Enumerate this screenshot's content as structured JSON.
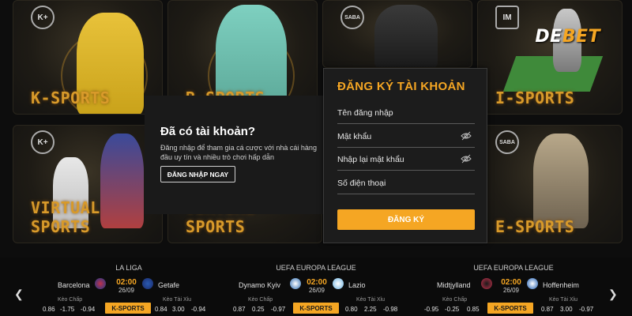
{
  "brand": {
    "left": "DE",
    "right": "BET"
  },
  "tiles": {
    "ksports": {
      "label": "K-SPORTS",
      "logo": "K+"
    },
    "bsports": {
      "label": "B-SPORTS"
    },
    "ssports": {
      "logo": "SABA"
    },
    "isports": {
      "label": "I-SPORTS",
      "logo": "IM"
    },
    "virtual1": {
      "label": "VIRTUAL SPORTS",
      "logo": "K+"
    },
    "virtual2": {
      "label": "VIRTUAL SPORTS"
    },
    "esports": {
      "label": "E-SPORTS",
      "logo": "SABA"
    }
  },
  "login": {
    "title": "Đã có tài khoản?",
    "description": "Đăng nhập để tham gia cá cược với nhà cái hàng đầu uy tín và nhiều trò chơi hấp dẫn",
    "button": "ĐĂNG NHẬP NGAY"
  },
  "register": {
    "title": "ĐĂNG KÝ TÀI KHOẢN",
    "fields": [
      {
        "placeholder": "Tên đăng nhập"
      },
      {
        "placeholder": "Mật khẩu"
      },
      {
        "placeholder": "Nhập lại mật khẩu"
      },
      {
        "placeholder": "Số điện thoại"
      }
    ],
    "button": "ĐĂNG KÝ"
  },
  "matches": [
    {
      "league": "LA LIGA",
      "home": "Barcelona",
      "away": "Getafe",
      "time": "02:00",
      "date": "26/09",
      "handicap_label": "Kèo Chấp",
      "total_label": "Kèo Tài Xỉu",
      "handicap": [
        "0.86",
        "-1.75",
        "-0.94"
      ],
      "total": [
        "0.84",
        "3.00",
        "-0.94"
      ],
      "chip": "K-SPORTS"
    },
    {
      "league": "UEFA EUROPA LEAGUE",
      "home": "Dynamo Kyiv",
      "away": "Lazio",
      "time": "02:00",
      "date": "26/09",
      "handicap_label": "Kèo Chấp",
      "total_label": "Kèo Tài Xỉu",
      "handicap": [
        "0.87",
        "0.25",
        "-0.97"
      ],
      "total": [
        "0.80",
        "2.25",
        "-0.98"
      ],
      "chip": "K-SPORTS"
    },
    {
      "league": "UEFA EUROPA LEAGUE",
      "home": "Midtjylland",
      "away": "Hoffenheim",
      "time": "02:00",
      "date": "26/09",
      "handicap_label": "Kèo Chấp",
      "total_label": "Kèo Tài Xỉu",
      "handicap": [
        "-0.95",
        "-0.25",
        "0.85"
      ],
      "total": [
        "0.87",
        "3.00",
        "-0.97"
      ],
      "chip": "K-SPORTS"
    }
  ],
  "colors": {
    "accent": "#f5a623",
    "panel": "#1c1c1c",
    "background": "#0d0d0d"
  }
}
